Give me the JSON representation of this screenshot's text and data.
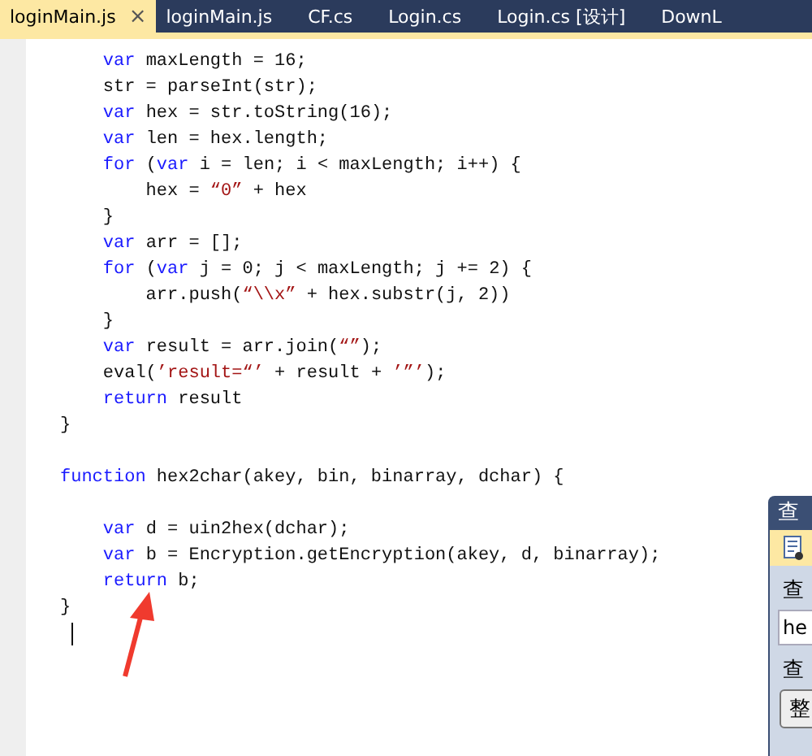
{
  "tabs": [
    {
      "label": "loginMain.js",
      "selected": true,
      "close": "×"
    },
    {
      "label": "loginMain.js",
      "selected": false
    },
    {
      "label": "CF.cs",
      "selected": false
    },
    {
      "label": "Login.cs",
      "selected": false
    },
    {
      "label": "Login.cs [设计]",
      "selected": false
    },
    {
      "label": "DownL",
      "selected": false
    }
  ],
  "code": [
    {
      "kind": "code",
      "segments": [
        {
          "kind": "keyword",
          "text": "    var"
        },
        {
          "kind": "plain",
          "text": " maxLength = 16;"
        }
      ]
    },
    {
      "kind": "code",
      "segments": [
        {
          "kind": "plain",
          "text": "    str = parseInt(str);"
        }
      ]
    },
    {
      "kind": "code",
      "segments": [
        {
          "kind": "keyword",
          "text": "    var"
        },
        {
          "kind": "plain",
          "text": " hex = str.toString(16);"
        }
      ]
    },
    {
      "kind": "code",
      "segments": [
        {
          "kind": "keyword",
          "text": "    var"
        },
        {
          "kind": "plain",
          "text": " len = hex.length;"
        }
      ]
    },
    {
      "kind": "code",
      "segments": [
        {
          "kind": "keyword",
          "text": "    for"
        },
        {
          "kind": "plain",
          "text": " ("
        },
        {
          "kind": "keyword",
          "text": "var"
        },
        {
          "kind": "plain",
          "text": " i = len; i < maxLength; i++) {"
        }
      ]
    },
    {
      "kind": "code",
      "segments": [
        {
          "kind": "plain",
          "text": "        hex = "
        },
        {
          "kind": "string",
          "text": "“0”"
        },
        {
          "kind": "plain",
          "text": " + hex"
        }
      ]
    },
    {
      "kind": "code",
      "segments": [
        {
          "kind": "plain",
          "text": "    }"
        }
      ]
    },
    {
      "kind": "code",
      "segments": [
        {
          "kind": "keyword",
          "text": "    var"
        },
        {
          "kind": "plain",
          "text": " arr = [];"
        }
      ]
    },
    {
      "kind": "code",
      "segments": [
        {
          "kind": "keyword",
          "text": "    for"
        },
        {
          "kind": "plain",
          "text": " ("
        },
        {
          "kind": "keyword",
          "text": "var"
        },
        {
          "kind": "plain",
          "text": " j = 0; j < maxLength; j += 2) {"
        }
      ]
    },
    {
      "kind": "code",
      "segments": [
        {
          "kind": "plain",
          "text": "        arr.push("
        },
        {
          "kind": "string",
          "text": "“\\\\x”"
        },
        {
          "kind": "plain",
          "text": " + hex.substr(j, 2))"
        }
      ]
    },
    {
      "kind": "code",
      "segments": [
        {
          "kind": "plain",
          "text": "    }"
        }
      ]
    },
    {
      "kind": "code",
      "segments": [
        {
          "kind": "keyword",
          "text": "    var"
        },
        {
          "kind": "plain",
          "text": " result = arr.join("
        },
        {
          "kind": "string",
          "text": "“”"
        },
        {
          "kind": "plain",
          "text": ");"
        }
      ]
    },
    {
      "kind": "code",
      "segments": [
        {
          "kind": "plain",
          "text": "    eval("
        },
        {
          "kind": "string",
          "text": "’result=“’"
        },
        {
          "kind": "plain",
          "text": " + result + "
        },
        {
          "kind": "string",
          "text": "’”’"
        },
        {
          "kind": "plain",
          "text": ");"
        }
      ]
    },
    {
      "kind": "code",
      "segments": [
        {
          "kind": "keyword",
          "text": "    return"
        },
        {
          "kind": "plain",
          "text": " result"
        }
      ]
    },
    {
      "kind": "code",
      "segments": [
        {
          "kind": "plain",
          "text": "}"
        }
      ]
    },
    {
      "kind": "blank"
    },
    {
      "kind": "code",
      "segments": [
        {
          "kind": "keyword",
          "text": "function"
        },
        {
          "kind": "plain",
          "text": " hex2char(akey, bin, binarray, dchar) {"
        }
      ]
    },
    {
      "kind": "blank"
    },
    {
      "kind": "code",
      "segments": [
        {
          "kind": "keyword",
          "text": "    var"
        },
        {
          "kind": "plain",
          "text": " d = uin2hex(dchar);"
        }
      ]
    },
    {
      "kind": "code",
      "segments": [
        {
          "kind": "keyword",
          "text": "    var"
        },
        {
          "kind": "plain",
          "text": " b = Encryption.getEncryption(akey, d, binarray);"
        }
      ]
    },
    {
      "kind": "code",
      "segments": [
        {
          "kind": "keyword",
          "text": "    return"
        },
        {
          "kind": "plain",
          "text": " b;"
        }
      ]
    },
    {
      "kind": "code",
      "segments": [
        {
          "kind": "plain",
          "text": "}"
        }
      ]
    }
  ],
  "find_panel": {
    "title": "查",
    "label_1": "查",
    "value": "he",
    "label_2": "查",
    "button": "整"
  }
}
